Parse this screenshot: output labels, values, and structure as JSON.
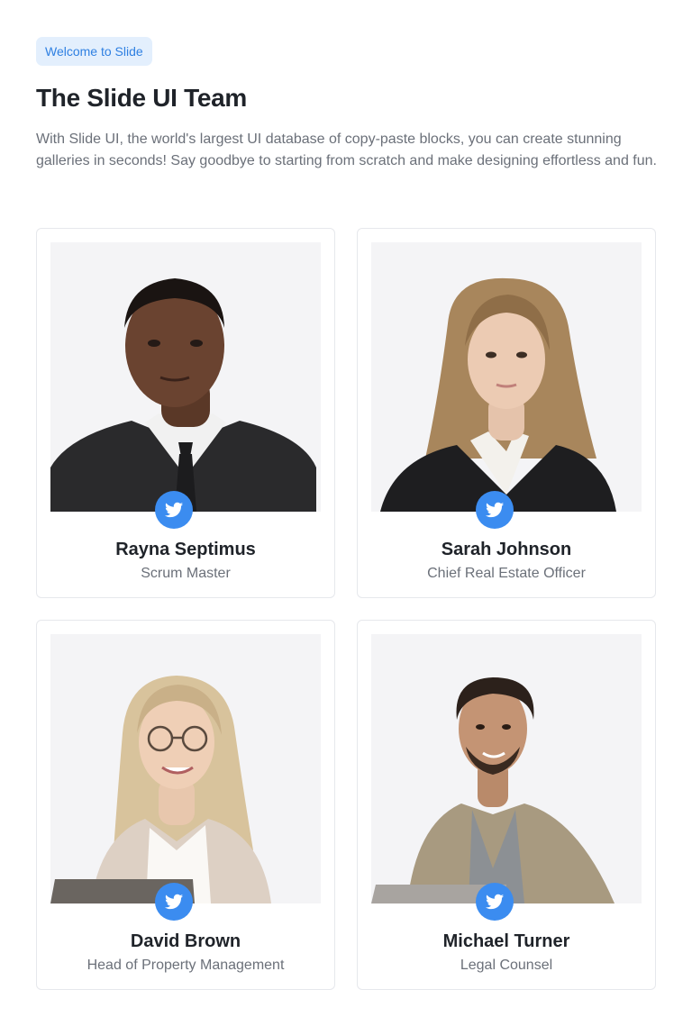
{
  "header": {
    "badge": "Welcome to Slide",
    "title": "The Slide UI Team",
    "description": "With Slide UI, the world's largest UI database of copy-paste blocks, you can create stunning galleries in seconds! Say goodbye to starting from scratch and make designing effortless and fun."
  },
  "team": [
    {
      "name": "Rayna Septimus",
      "role": "Scrum Master",
      "social_icon": "twitter-icon"
    },
    {
      "name": "Sarah Johnson",
      "role": "Chief Real Estate Officer",
      "social_icon": "twitter-icon"
    },
    {
      "name": "David Brown",
      "role": "Head of Property Management",
      "social_icon": "twitter-icon"
    },
    {
      "name": "Michael Turner",
      "role": "Legal Counsel",
      "social_icon": "twitter-icon"
    }
  ],
  "colors": {
    "accent": "#3b8cf0",
    "badge_bg": "#e3effd",
    "badge_text": "#2f80e2",
    "photo_bg": "#f4f4f6"
  }
}
